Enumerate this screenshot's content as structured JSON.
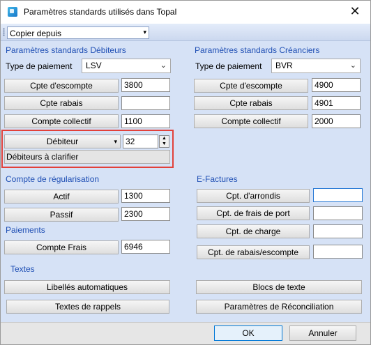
{
  "window": {
    "title": "Paramètres standards utilisés dans Topal",
    "close_glyph": "✕"
  },
  "toolbar": {
    "copy_from_label": "Copier depuis",
    "dropdown_arrow": "▾"
  },
  "debtors": {
    "section_title": "Paramètres standards Débiteurs",
    "payment_type_label": "Type de paiement",
    "payment_type_value": "LSV",
    "discount_account_label": "Cpte d'escompte",
    "discount_account_value": "3800",
    "rebate_account_label": "Cpte rabais",
    "rebate_account_value": "",
    "collective_account_label": "Compte collectif",
    "collective_account_value": "1100",
    "debtor_button_label": "Débiteur",
    "debtor_button_arrow": "▾",
    "debtor_number": "32",
    "spin_up": "▲",
    "spin_down": "▼",
    "debtor_description": "Débiteurs à clarifier"
  },
  "creditors": {
    "section_title": "Paramètres standards Créanciers",
    "payment_type_label": "Type de paiement",
    "payment_type_value": "BVR",
    "discount_account_label": "Cpte d'escompte",
    "discount_account_value": "4900",
    "rebate_account_label": "Cpte rabais",
    "rebate_account_value": "4901",
    "collective_account_label": "Compte collectif",
    "collective_account_value": "2000"
  },
  "regularisation": {
    "section_title": "Compte de régularisation",
    "assets_label": "Actif",
    "assets_value": "1300",
    "liabilities_label": "Passif",
    "liabilities_value": "2300"
  },
  "payments": {
    "section_title": "Paiements",
    "fee_account_label": "Compte Frais",
    "fee_account_value": "6946"
  },
  "einvoices": {
    "section_title": "E-Factures",
    "rounding_label": "Cpt. d'arrondis",
    "rounding_value": "",
    "shipping_label": "Cpt. de frais de port",
    "shipping_value": "",
    "charge_label": "Cpt. de charge",
    "charge_value": "",
    "rebate_discount_label": "Cpt. de rabais/escompte",
    "rebate_discount_value": ""
  },
  "texts": {
    "section_title": "Textes",
    "auto_labels_button": "Libellés automatiques",
    "text_blocks_button": "Blocs de texte",
    "reminder_texts_button": "Textes de rappels",
    "reconciliation_button": "Paramètres de Réconciliation"
  },
  "footer": {
    "ok_label": "OK",
    "cancel_label": "Annuler"
  },
  "colors": {
    "dialog_background": "#d6e2f6",
    "section_title": "#1f4fb4",
    "highlight_border": "#e2413a",
    "focus_border": "#2b7bd6"
  },
  "icons": {
    "app_icon": "topal-app-icon",
    "close": "close-icon",
    "dropdown": "chevron-down-icon",
    "spinner": "spin-arrows-icon"
  }
}
